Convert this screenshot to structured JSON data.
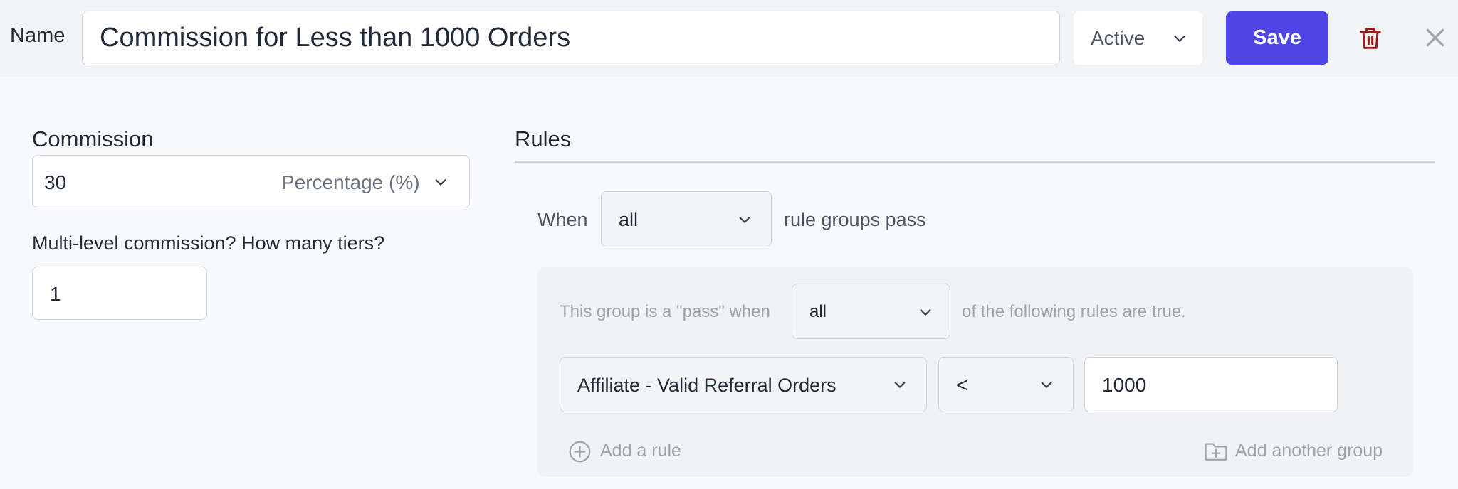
{
  "header": {
    "name_label": "Name",
    "name_value": "Commission for Less than 1000 Orders",
    "status_value": "Active",
    "save_label": "Save"
  },
  "commission": {
    "title": "Commission",
    "amount": "30",
    "type": "Percentage (%)",
    "tiers_label": "Multi-level commission? How many tiers?",
    "tiers_value": "1"
  },
  "rules": {
    "title": "Rules",
    "when_label": "When",
    "when_value": "all",
    "suffix": "rule groups pass",
    "group": {
      "prefix": "This group is a \"pass\" when",
      "match_value": "all",
      "suffix": "of the following rules are true.",
      "rule": {
        "field": "Affiliate - Valid Referral Orders",
        "operator": "<",
        "value": "1000"
      },
      "add_rule_label": "Add a rule",
      "add_group_label": "Add another group"
    }
  },
  "colors": {
    "accent": "#4f46e5",
    "danger": "#991b1b"
  },
  "icons": [
    "chevron-down-icon",
    "trash-icon",
    "close-icon",
    "plus-circle-icon",
    "folder-plus-icon"
  ]
}
